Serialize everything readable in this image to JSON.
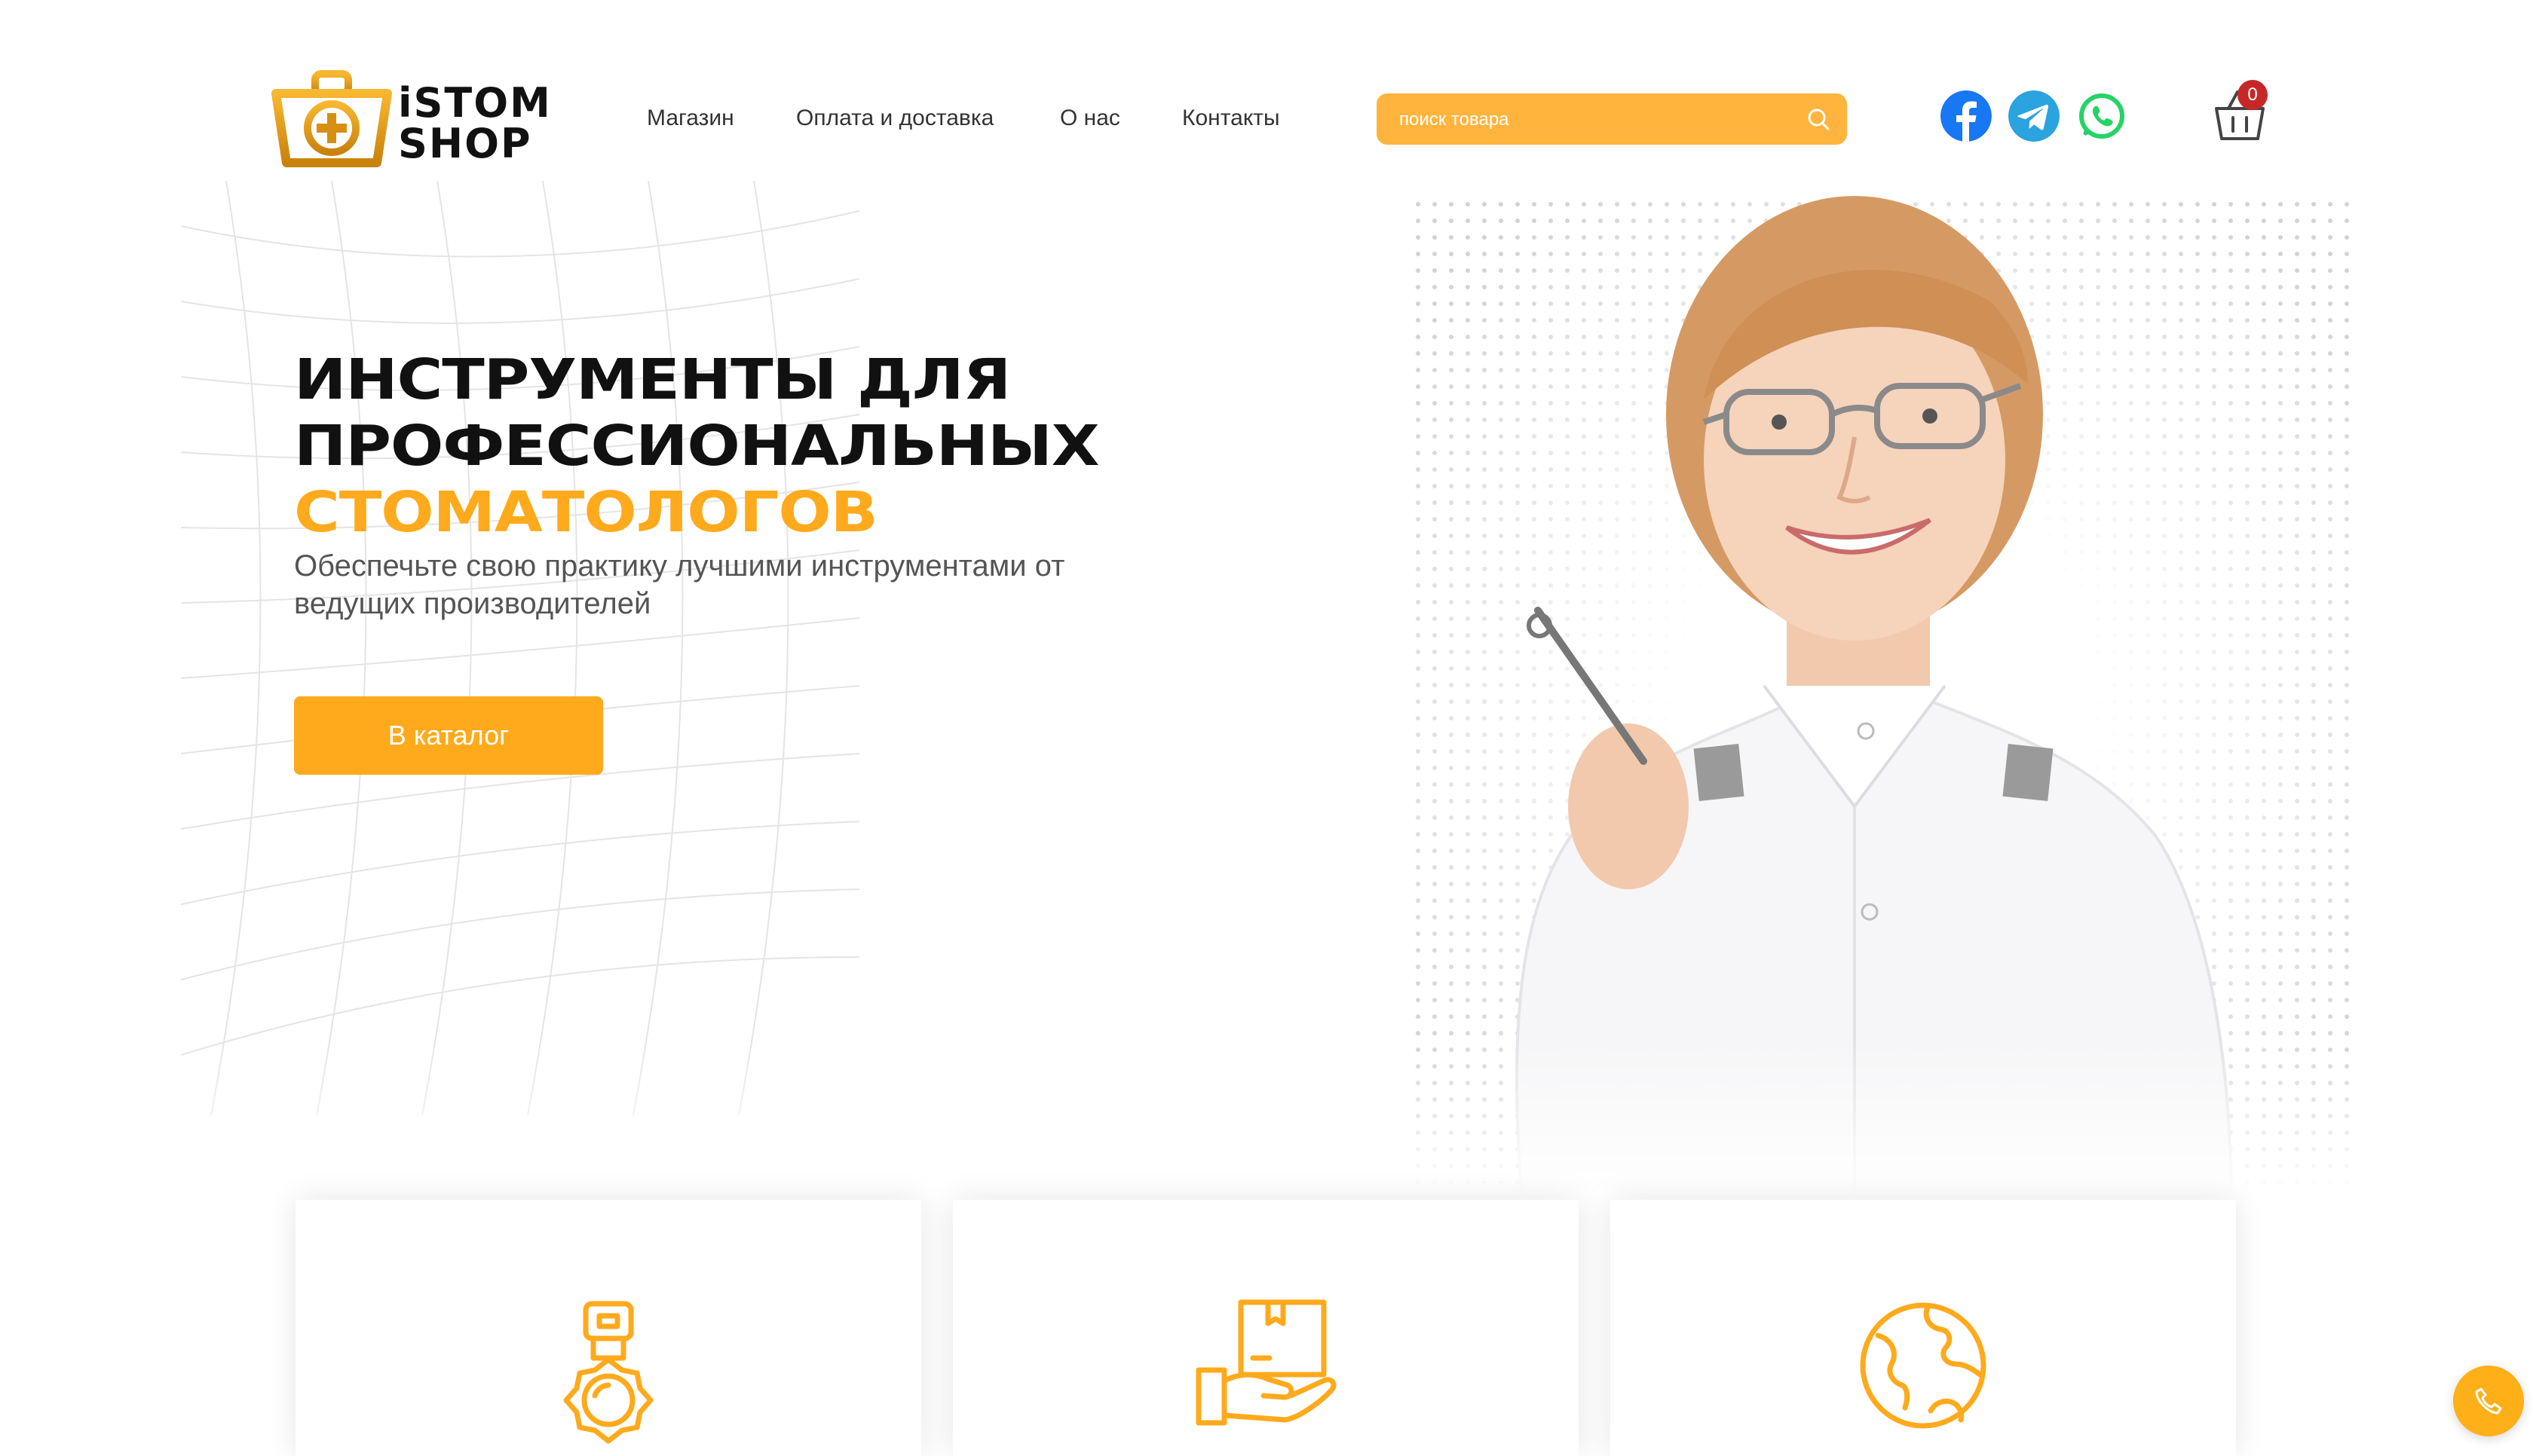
{
  "logo": {
    "line1": "iSTOM",
    "line2": "SHOP"
  },
  "nav": [
    {
      "label": "Магазин"
    },
    {
      "label": "Оплата и доставка"
    },
    {
      "label": "О нас"
    },
    {
      "label": "Контакты"
    }
  ],
  "search": {
    "placeholder": "поиск товара",
    "value": ""
  },
  "social": [
    {
      "icon": "facebook-icon",
      "color": "#1877f2"
    },
    {
      "icon": "telegram-icon",
      "color": "#2aa3df"
    },
    {
      "icon": "whatsapp-icon",
      "color": "#25d366"
    }
  ],
  "cart": {
    "count": "0",
    "icon": "basket-icon"
  },
  "hero": {
    "title_line1": "ИНСТРУМЕНТЫ ДЛЯ",
    "title_line2": "ПРОФЕССИОНАЛЬНЫХ",
    "title_accent": "СТОМАТОЛОГОВ",
    "subtitle": "Обеспечьте свою практику лучшими инструментами от ведущих производителей",
    "cta": "В каталог"
  },
  "features": [
    {
      "icon": "medal-icon"
    },
    {
      "icon": "box-in-hand-icon"
    },
    {
      "icon": "globe-icon"
    }
  ],
  "colors": {
    "accent": "#ffaa1c",
    "search_bg": "#ffb43e",
    "badge": "#c62828",
    "text": "#111111"
  },
  "call_button": {
    "icon": "phone-icon"
  }
}
